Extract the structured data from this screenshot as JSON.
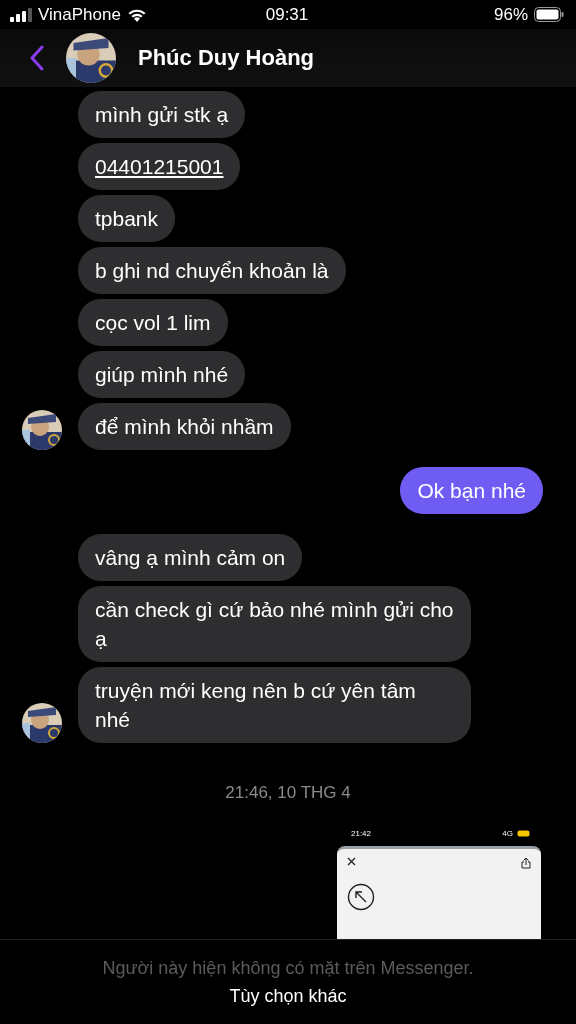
{
  "status_bar": {
    "carrier": "VinaPhone",
    "time": "09:31",
    "battery": "96%"
  },
  "header": {
    "contact_name": "Phúc Duy Hoàng"
  },
  "messages": [
    {
      "kind": "incoming",
      "text": "mình gửi stk ạ",
      "link": false,
      "avatar": false
    },
    {
      "kind": "incoming",
      "text": "04401215001",
      "link": true,
      "avatar": false
    },
    {
      "kind": "incoming",
      "text": "tpbank",
      "link": false,
      "avatar": false
    },
    {
      "kind": "incoming",
      "text": "b ghi nd chuyển khoản là",
      "link": false,
      "avatar": false
    },
    {
      "kind": "incoming",
      "text": "cọc vol 1 lim",
      "link": false,
      "avatar": false
    },
    {
      "kind": "incoming",
      "text": "giúp mình nhé",
      "link": false,
      "avatar": false
    },
    {
      "kind": "incoming",
      "text": "để mình khỏi nhầm",
      "link": false,
      "avatar": true
    },
    {
      "kind": "outgoing",
      "text": "Ok bạn nhé",
      "link": false,
      "avatar": false
    },
    {
      "kind": "incoming",
      "text": "vâng ạ mình cảm on",
      "link": false,
      "avatar": false
    },
    {
      "kind": "incoming",
      "text": "cần check gì cứ bảo nhé mình gửi cho ạ",
      "link": false,
      "avatar": false
    },
    {
      "kind": "incoming",
      "text": "truyện mới keng nên b cứ yên tâm nhé",
      "link": false,
      "avatar": true
    }
  ],
  "timestamp": "21:46, 10 THG 4",
  "attachment": {
    "kind": "screenshot",
    "time": "21:42",
    "network": "4G"
  },
  "footer": {
    "notice": "Người này hiện không có mặt trên Messenger.",
    "action": "Tùy chọn khác"
  }
}
